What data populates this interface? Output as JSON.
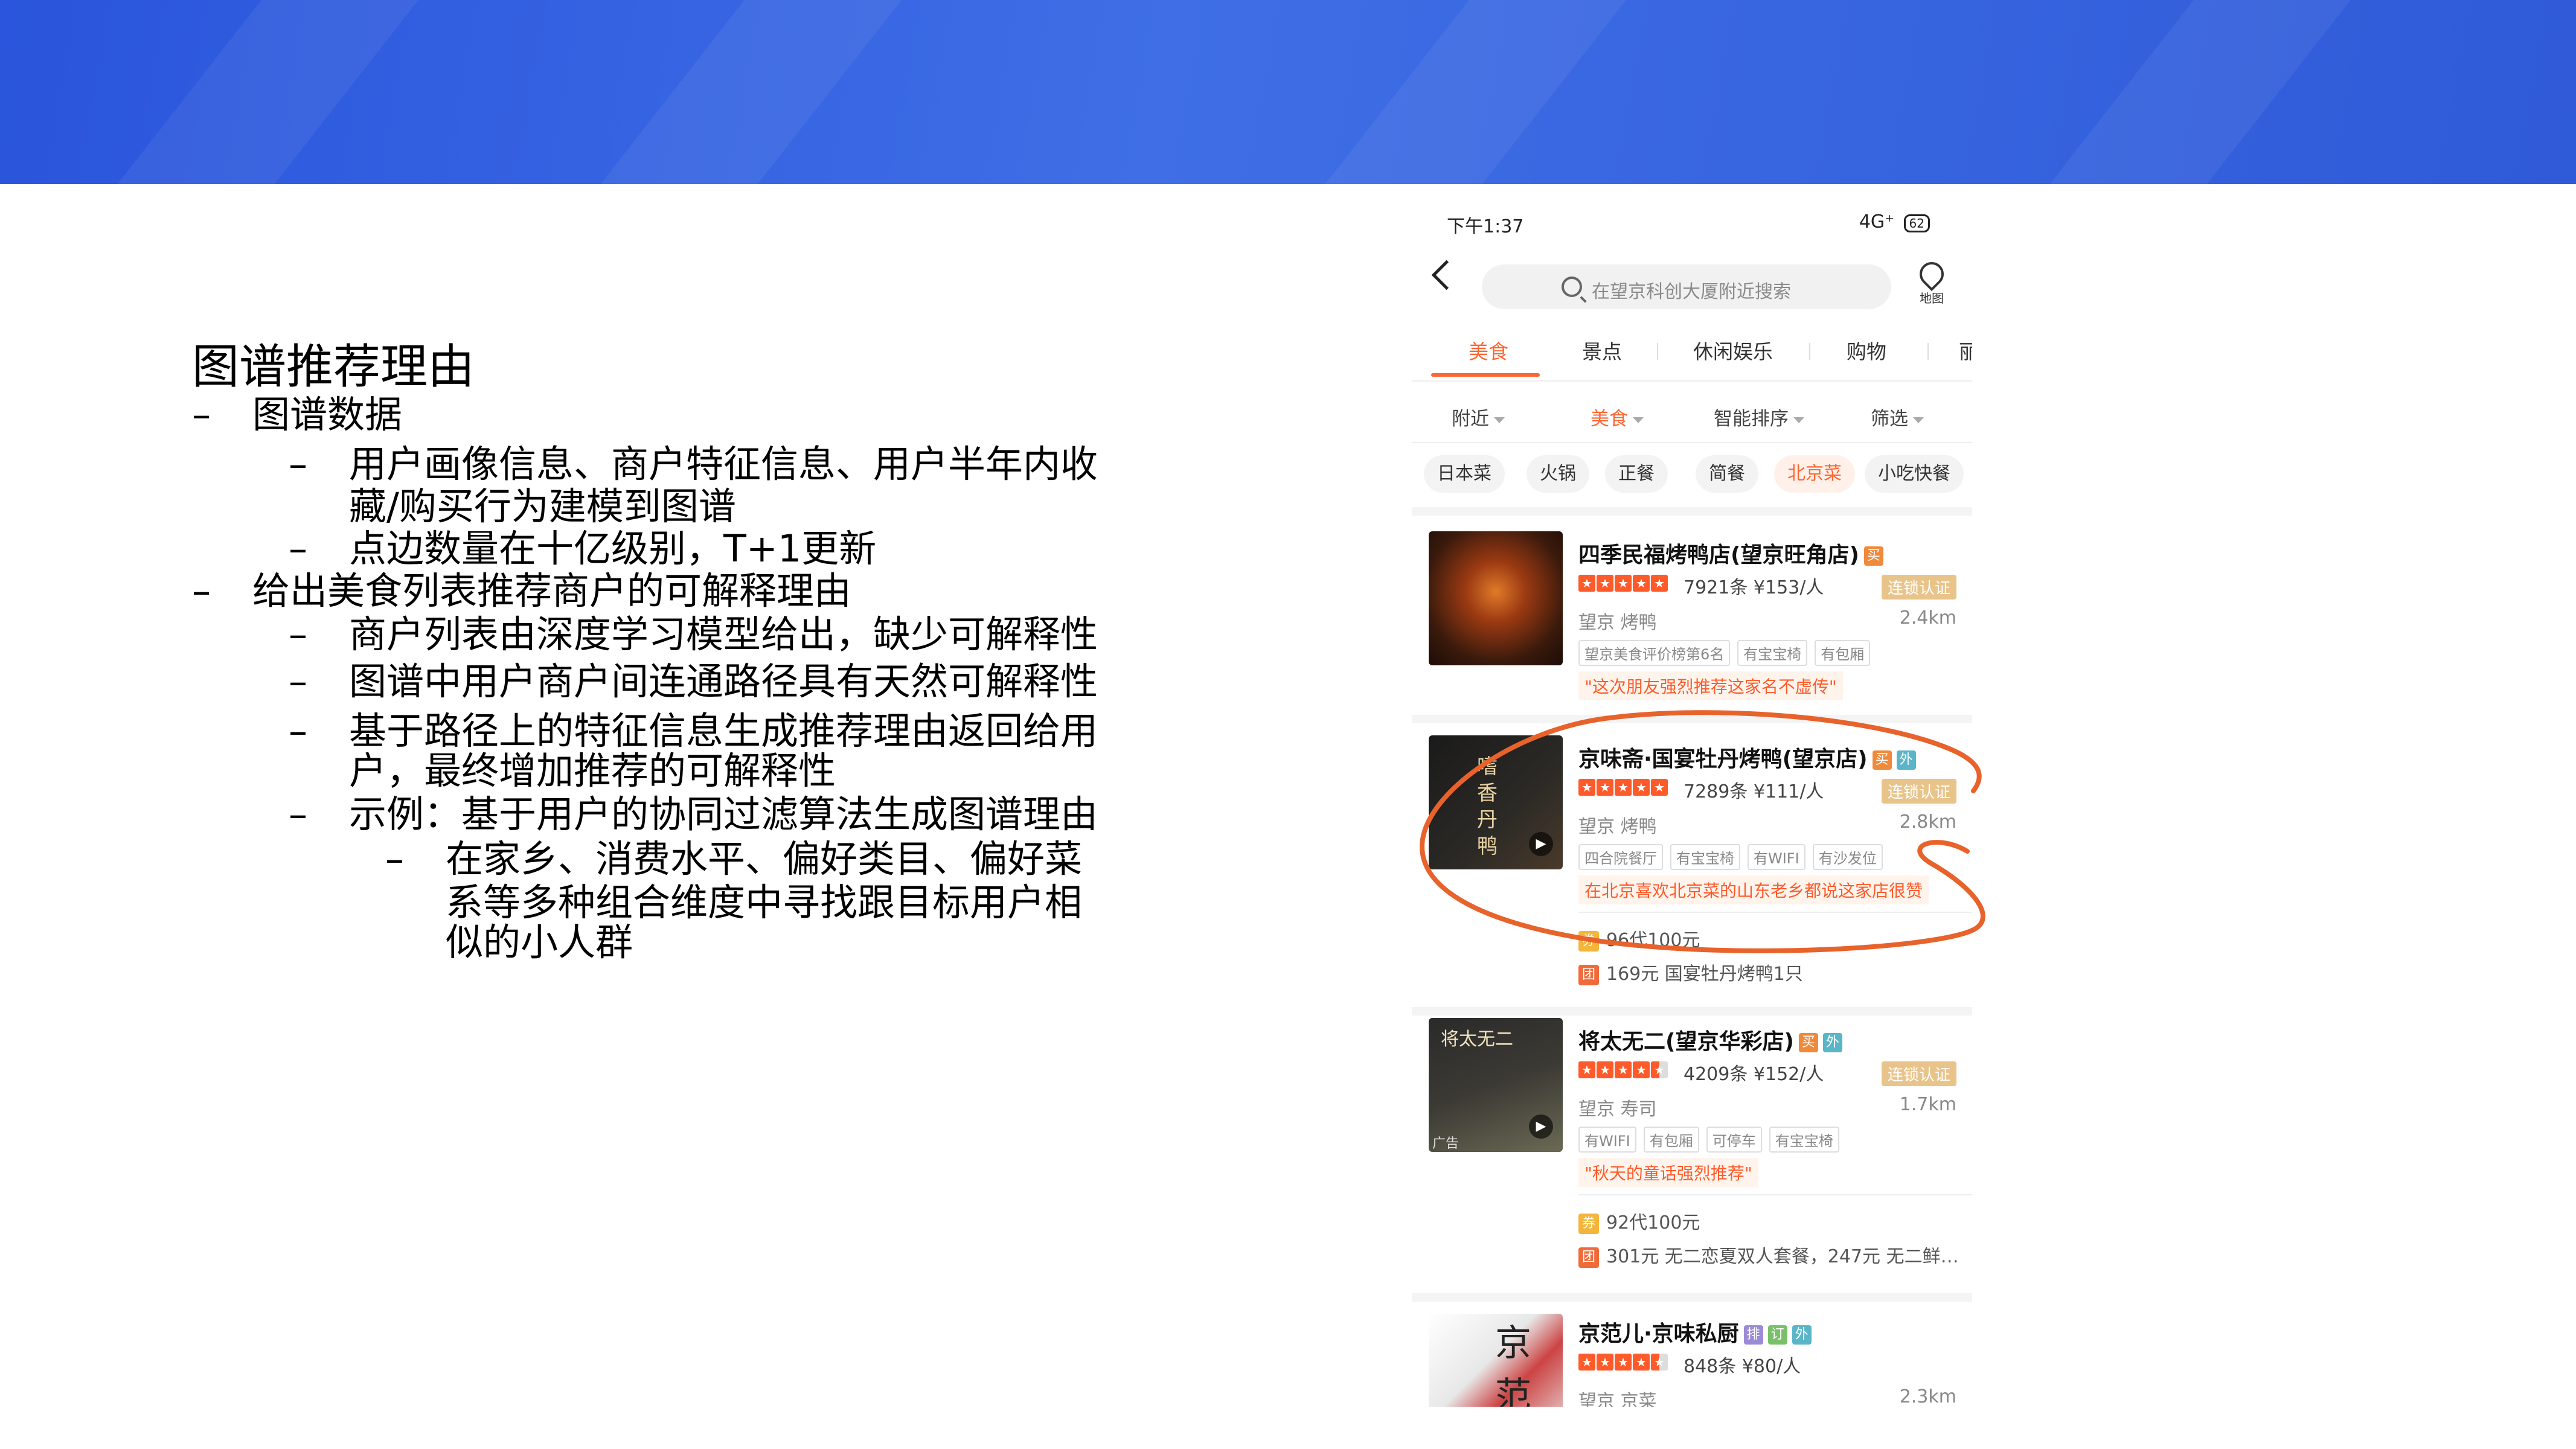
{
  "colors": {
    "header_band": "#2f5ad8",
    "accent": "#ff6633",
    "circle_mark": "#e8622b"
  },
  "slide": {
    "title": "图谱推荐理由",
    "bullets": [
      {
        "level": 1,
        "text": "图谱数据"
      },
      {
        "level": 2,
        "text": "用户画像信息、商户特征信息、用户半年内收"
      },
      {
        "level": 2,
        "text": "藏/购买行为建模到图谱",
        "continuation": true
      },
      {
        "level": 2,
        "text": "点边数量在十亿级别，T+1更新"
      },
      {
        "level": 1,
        "text": "给出美食列表推荐商户的可解释理由"
      },
      {
        "level": 2,
        "text": "商户列表由深度学习模型给出，缺少可解释性"
      },
      {
        "level": 2,
        "text": "图谱中用户商户间连通路径具有天然可解释性"
      },
      {
        "level": 2,
        "text": "基于路径上的特征信息生成推荐理由返回给用"
      },
      {
        "level": 2,
        "text": "户，最终增加推荐的可解释性",
        "continuation": true
      },
      {
        "level": 2,
        "text": "示例：基于用户的协同过滤算法生成图谱理由"
      },
      {
        "level": 3,
        "text": "在家乡、消费水平、偏好类目、偏好菜"
      },
      {
        "level": 3,
        "text": "系等多种组合维度中寻找跟目标用户相",
        "continuation": true
      },
      {
        "level": 3,
        "text": "似的小人群",
        "continuation": true
      }
    ],
    "dash": "–"
  },
  "phone": {
    "status": {
      "time": "下午1:37",
      "right": "4G⁺",
      "battery": "62"
    },
    "search_placeholder": "在望京科创大厦附近搜索",
    "map_label": "地图",
    "tabs": [
      "美食",
      "景点",
      "休闲娱乐",
      "购物",
      "丽"
    ],
    "filters": [
      "附近",
      "美食",
      "智能排序",
      "筛选"
    ],
    "chips": [
      "日本菜",
      "火锅",
      "正餐",
      "简餐",
      "北京菜",
      "小吃快餐"
    ],
    "shops": [
      {
        "name": "四季民福烤鸭店(望京旺角店)",
        "badges": [
          "买"
        ],
        "rating": 5,
        "reviews": "7921条",
        "price": "¥153/人",
        "cert": "连锁认证",
        "area": "望京  烤鸭",
        "distance": "2.4km",
        "feature_tags": [
          "望京美食评价榜第6名",
          "有宝宝椅",
          "有包厢"
        ],
        "quote": "\"这次朋友强烈推荐这家名不虚传\""
      },
      {
        "name": "京味斋·国宴牡丹烤鸭(望京店)",
        "badges": [
          "买",
          "外"
        ],
        "rating": 5,
        "reviews": "7289条",
        "price": "¥111/人",
        "cert": "连锁认证",
        "area": "望京  烤鸭",
        "distance": "2.8km",
        "feature_tags": [
          "四合院餐厅",
          "有宝宝椅",
          "有WIFI",
          "有沙发位"
        ],
        "quote": "在北京喜欢北京菜的山东老乡都说这家店很赞",
        "deals": [
          {
            "icon": "券",
            "text": "96代100元"
          },
          {
            "icon": "团",
            "text": "169元 国宴牡丹烤鸭1只"
          }
        ],
        "image_text": "嗜香丹鸭"
      },
      {
        "name": "将太无二(望京华彩店)",
        "badges": [
          "买",
          "外"
        ],
        "rating": 4.5,
        "reviews": "4209条",
        "price": "¥152/人",
        "cert": "连锁认证",
        "area": "望京  寿司",
        "distance": "1.7km",
        "feature_tags": [
          "有WIFI",
          "有包厢",
          "可停车",
          "有宝宝椅"
        ],
        "quote": "\"秋天的童话强烈推荐\"",
        "deals": [
          {
            "icon": "券",
            "text": "92代100元"
          },
          {
            "icon": "团",
            "text": "301元 无二恋夏双人套餐，247元 无二鲜…"
          }
        ],
        "image_text": "将太无二",
        "ad_label": "广告"
      },
      {
        "name": "京范儿·京味私厨",
        "badges": [
          "排",
          "订",
          "外"
        ],
        "rating": 4.5,
        "reviews": "848条",
        "price": "¥80/人",
        "area": "望京  京菜",
        "distance": "2.3km",
        "image_text": "京范"
      }
    ]
  }
}
